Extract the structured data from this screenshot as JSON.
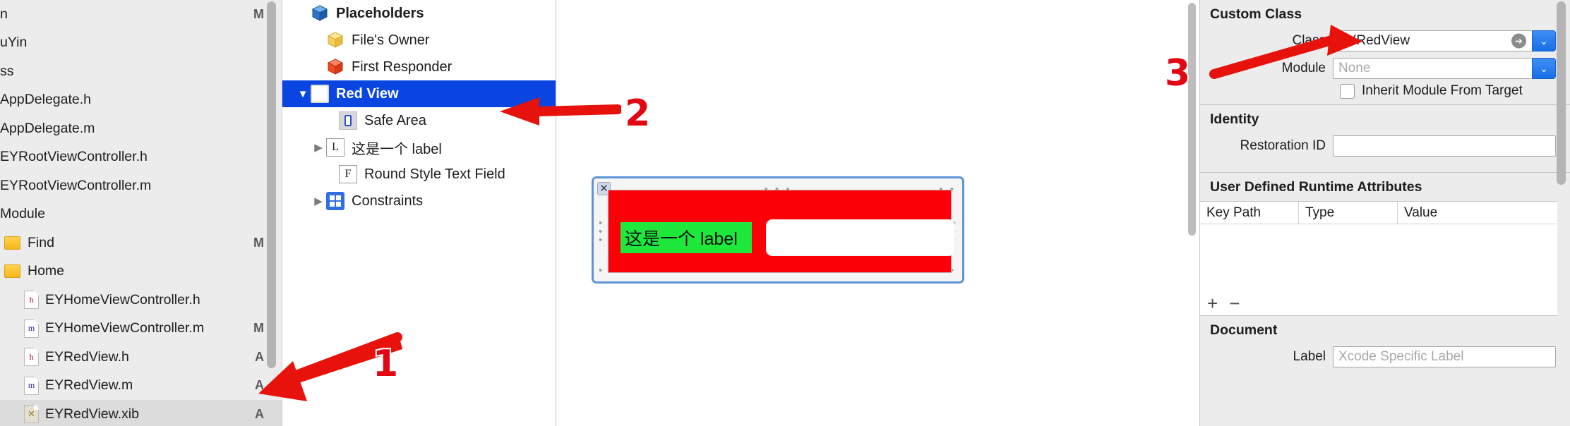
{
  "navigator": {
    "rows": [
      {
        "label": "n",
        "status": "M",
        "icon": "none",
        "indent": 0
      },
      {
        "label": "uYin",
        "status": "",
        "icon": "none",
        "indent": 0
      },
      {
        "label": "ss",
        "status": "",
        "icon": "none",
        "indent": 0
      },
      {
        "label": "AppDelegate.h",
        "status": "",
        "icon": "none",
        "indent": 0
      },
      {
        "label": "AppDelegate.m",
        "status": "",
        "icon": "none",
        "indent": 0
      },
      {
        "label": "EYRootViewController.h",
        "status": "",
        "icon": "none",
        "indent": 0
      },
      {
        "label": "EYRootViewController.m",
        "status": "",
        "icon": "none",
        "indent": 0
      },
      {
        "label": "Module",
        "status": "",
        "icon": "none",
        "indent": 0
      },
      {
        "label": "Find",
        "status": "M",
        "icon": "folder",
        "indent": 1
      },
      {
        "label": "Home",
        "status": "",
        "icon": "folder",
        "indent": 1
      },
      {
        "label": "EYHomeViewController.h",
        "status": "",
        "icon": "h",
        "indent": 2
      },
      {
        "label": "EYHomeViewController.m",
        "status": "M",
        "icon": "m",
        "indent": 2
      },
      {
        "label": "EYRedView.h",
        "status": "A",
        "icon": "h",
        "indent": 2
      },
      {
        "label": "EYRedView.m",
        "status": "A",
        "icon": "m",
        "indent": 2
      },
      {
        "label": "EYRedView.xib",
        "status": "A",
        "icon": "xib",
        "indent": 2,
        "selected": true
      }
    ]
  },
  "outline": {
    "rows": [
      {
        "label": "Placeholders",
        "icon": "cube-blue",
        "indent": 1,
        "bold": true,
        "disclosure": "none"
      },
      {
        "label": "File's Owner",
        "icon": "cube-yellow",
        "indent": 2,
        "bold": false,
        "disclosure": "none"
      },
      {
        "label": "First Responder",
        "icon": "cube-red",
        "indent": 2,
        "bold": false,
        "disclosure": "none"
      },
      {
        "label": "Red View",
        "icon": "view",
        "indent": 1,
        "bold": true,
        "disclosure": "down",
        "selected": true
      },
      {
        "label": "Safe Area",
        "icon": "safe-area",
        "indent": 3,
        "bold": false,
        "disclosure": "none"
      },
      {
        "label": "这是一个 label",
        "icon": "letter-L",
        "indent": 2,
        "bold": false,
        "disclosure": "right"
      },
      {
        "label": "Round Style Text Field",
        "icon": "letter-F",
        "indent": 3,
        "bold": false,
        "disclosure": "none"
      },
      {
        "label": "Constraints",
        "icon": "constraints",
        "indent": 2,
        "bold": false,
        "disclosure": "right"
      }
    ]
  },
  "canvas": {
    "label_text": "这是一个 label",
    "close_glyph": "✕",
    "handle_dots": "• • •",
    "handle_dots_corner": "• •",
    "handle_dots_vertical": "•\n•\n•",
    "red_color": "#fb0007",
    "green_color": "#1ee83c"
  },
  "inspector": {
    "custom_class": {
      "title": "Custom Class",
      "class_label": "Class",
      "class_value": "EYRedView",
      "module_label": "Module",
      "module_placeholder": "None",
      "inherit_label": "Inherit Module From Target"
    },
    "identity": {
      "title": "Identity",
      "restoration_label": "Restoration ID",
      "restoration_value": ""
    },
    "runtime": {
      "title": "User Defined Runtime Attributes",
      "columns": [
        "Key Path",
        "Type",
        "Value"
      ],
      "rows": [],
      "add_glyph": "+",
      "remove_glyph": "−"
    },
    "document": {
      "title": "Document",
      "label_label": "Label",
      "label_placeholder": "Xcode Specific Label"
    }
  },
  "annotations": {
    "marker_1": "1",
    "marker_2": "2",
    "marker_3": "3",
    "arrow_color": "#e8120c"
  }
}
